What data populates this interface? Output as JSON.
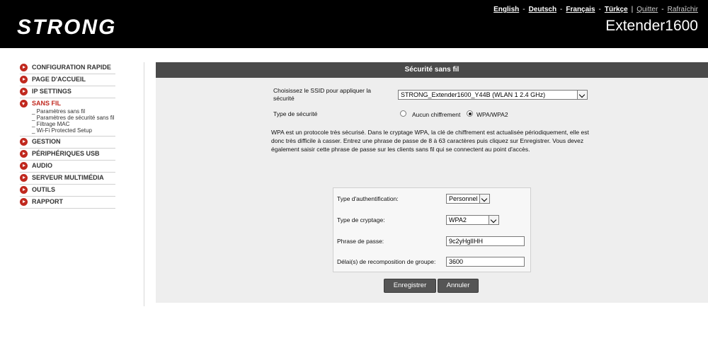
{
  "header": {
    "logo_text": "STRONG",
    "languages": [
      "English",
      "Deutsch",
      "Français",
      "Türkçe"
    ],
    "quit_label": "Quitter",
    "refresh_label": "Rafraîchir",
    "model": "Extender1600"
  },
  "sidebar": {
    "items": [
      {
        "label": "CONFIGURATION RAPIDE"
      },
      {
        "label": "PAGE D'ACCUEIL"
      },
      {
        "label": "IP SETTINGS"
      },
      {
        "label": "SANS FIL",
        "sub": [
          "Paramètres sans fil",
          "Paramètres de sécurité sans fil",
          "Filtrage MAC",
          "Wi-Fi Protected Setup"
        ]
      },
      {
        "label": "GESTION"
      },
      {
        "label": "PÉRIPHÉRIQUES USB"
      },
      {
        "label": "AUDIO"
      },
      {
        "label": "SERVEUR MULTIMÉDIA"
      },
      {
        "label": "OUTILS"
      },
      {
        "label": "RAPPORT"
      }
    ]
  },
  "main": {
    "title": "Sécurité sans fil",
    "ssid_label": "Choisissez le SSID pour appliquer la sécurité",
    "ssid_value": "STRONG_Extender1600_Y44B (WLAN 1 2.4 GHz)",
    "security_type_label": "Type de sécurité",
    "radio_none": "Aucun chiffrement",
    "radio_wpa": "WPA/WPA2",
    "description": "WPA est un protocole très sécurisé. Dans le cryptage WPA, la clé de chiffrement est actualisée périodiquement, elle est donc très difficile à casser. Entrez une phrase de passe de 8 à 63 caractères puis cliquez sur Enregistrer. Vous devez également saisir cette phrase de passe sur les clients sans fil qui se connectent au point d'accès.",
    "auth_type_label": "Type d'authentification:",
    "auth_type_value": "Personnel",
    "crypt_type_label": "Type de cryptage:",
    "crypt_type_value": "WPA2",
    "passphrase_label": "Phrase de passe:",
    "passphrase_value": "9c2yHglIHH",
    "rekey_label": "Délai(s) de recomposition de groupe:",
    "rekey_value": "3600",
    "save_label": "Enregistrer",
    "cancel_label": "Annuler"
  }
}
